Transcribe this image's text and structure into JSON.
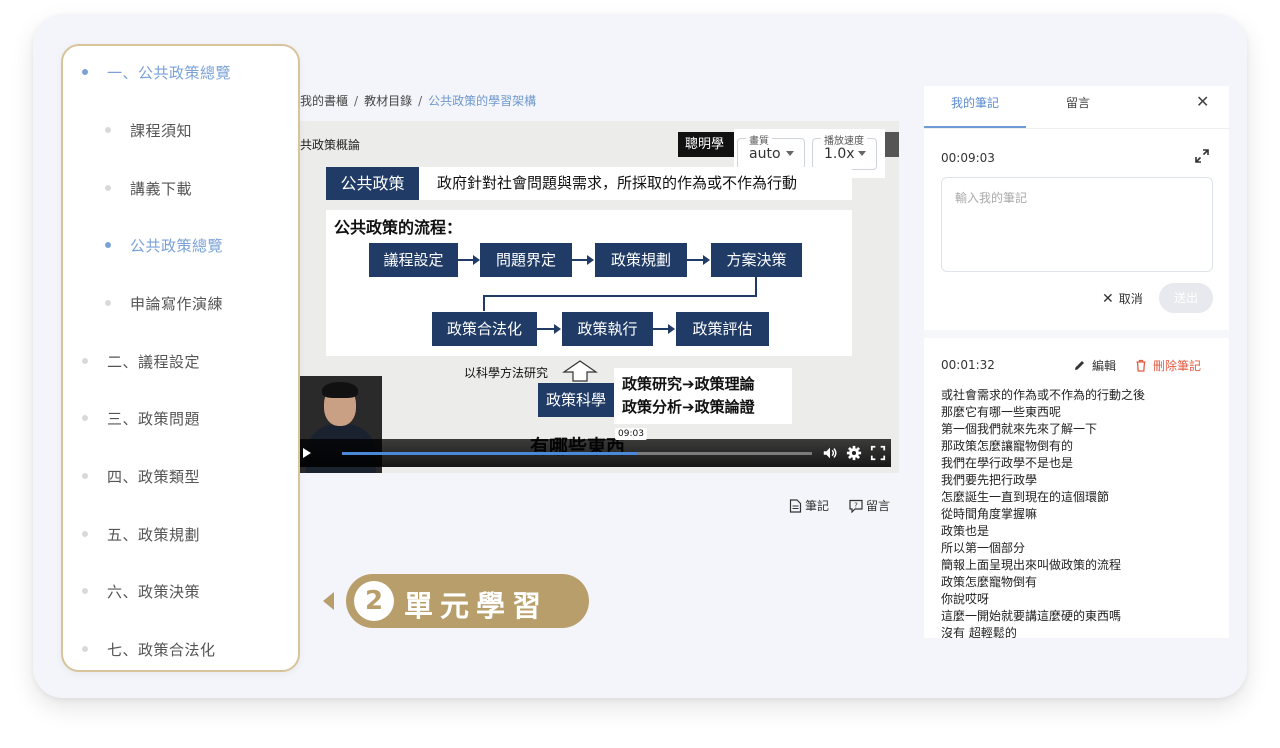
{
  "sidebar": {
    "items": [
      {
        "label": "一、公共政策總覽",
        "level": 1,
        "active": true
      },
      {
        "label": "課程須知",
        "level": 2,
        "active": false
      },
      {
        "label": "講義下載",
        "level": 2,
        "active": false
      },
      {
        "label": "公共政策總覽",
        "level": 2,
        "active": true
      },
      {
        "label": "申論寫作演練",
        "level": 2,
        "active": false
      },
      {
        "label": "二、議程設定",
        "level": 1,
        "active": false
      },
      {
        "label": "三、政策問題",
        "level": 1,
        "active": false
      },
      {
        "label": "四、政策類型",
        "level": 1,
        "active": false
      },
      {
        "label": "五、政策規劃",
        "level": 1,
        "active": false
      },
      {
        "label": "六、政策決策",
        "level": 1,
        "active": false
      },
      {
        "label": "七、政策合法化",
        "level": 1,
        "active": false
      }
    ]
  },
  "breadcrumb": {
    "items": [
      "我的書櫃",
      "教材目錄",
      "公共政策的學習架構"
    ],
    "separator": "/"
  },
  "video": {
    "slide_tag": "共政策概論",
    "brand_chip": "聰明學習",
    "quality": {
      "label": "畫質",
      "value": "auto"
    },
    "speed": {
      "label": "播放速度",
      "value": "1.0x"
    },
    "slide": {
      "term": "公共政策",
      "definition": "政府針對社會問題與需求，所採取的作為或不作為行動",
      "flow_title": "公共政策的流程：",
      "flow_steps": [
        "議程設定",
        "問題界定",
        "政策規劃",
        "方案決策",
        "政策合法化",
        "政策執行",
        "政策評估"
      ],
      "science_note": "以科學方法研究",
      "science_term": "政策科學",
      "science_lines": [
        "政策研究➔政策理論",
        "政策分析➔政策論證"
      ]
    },
    "subtitle_partial": "有哪些東西",
    "time_tooltip": "09:03",
    "progress": 0.63
  },
  "below_video": {
    "notes_label": "筆記",
    "comments_label": "留言"
  },
  "notes_panel": {
    "tabs": [
      "我的筆記",
      "留言"
    ],
    "current_time": "00:09:03",
    "input_placeholder": "輸入我的筆記",
    "cancel_label": "取消",
    "send_label": "送出",
    "saved_note": {
      "time": "00:01:32",
      "edit_label": "編輯",
      "delete_label": "刪除筆記",
      "lines": [
        "或社會需求的作為或不作為的行動之後",
        "那麼它有哪一些東西呢",
        "第一個我們就來先來了解一下",
        "那政策怎麼讓寵物倒有的",
        "我們在學行政學不是也是",
        "我們要先把行政學",
        "怎麼誕生一直到現在的這個環節",
        "從時間角度掌握嘛",
        "政策也是",
        "所以第一個部分",
        "簡報上面呈現出來叫做政策的流程",
        "政策怎麼寵物倒有",
        "你說哎呀",
        "這麼一開始就要講這麼硬的東西嗎",
        "沒有 超輕鬆的"
      ]
    }
  },
  "badge": {
    "number": "2",
    "text": "單元學習"
  },
  "colors": {
    "accent_blue": "#7aa2d8",
    "slide_navy": "#1f3b66",
    "badge_gold": "#b89e6b",
    "delete_red": "#e25c43"
  }
}
